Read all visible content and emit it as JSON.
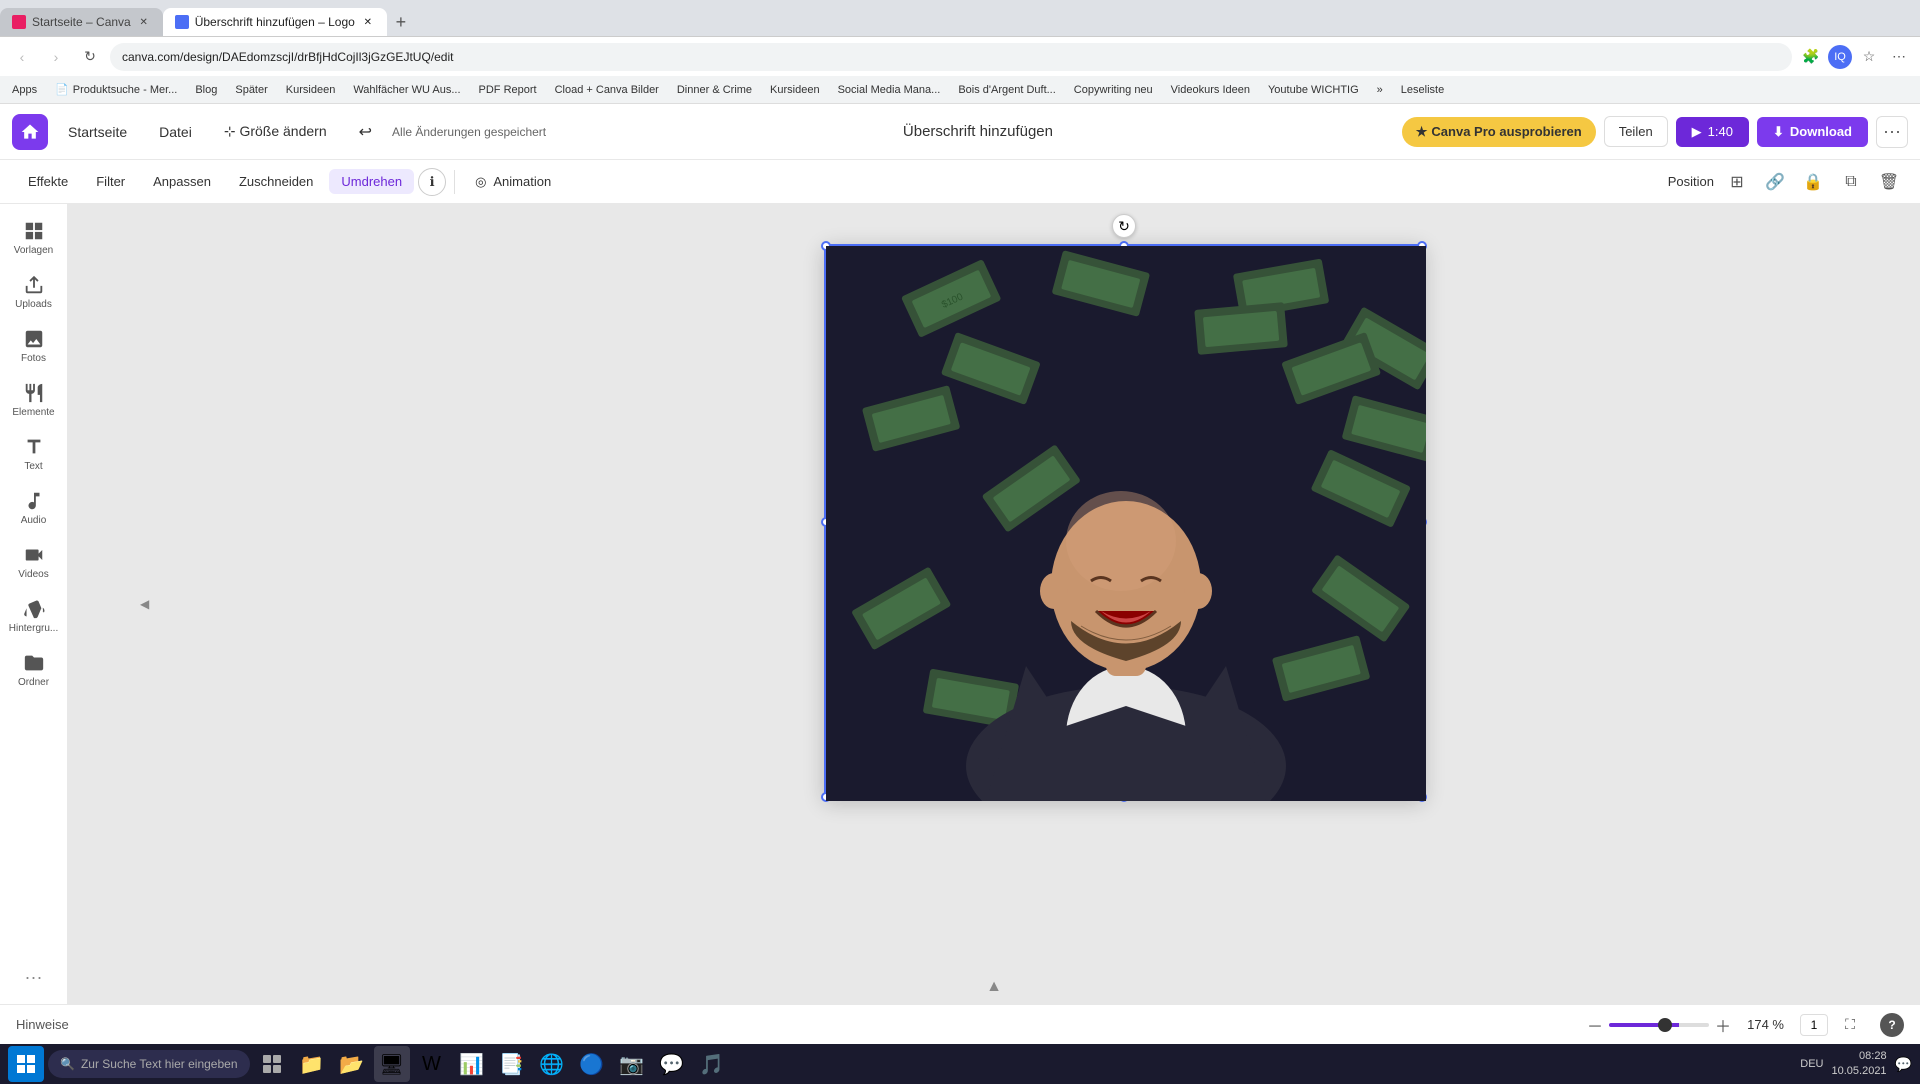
{
  "browser": {
    "tabs": [
      {
        "id": "tab1",
        "label": "Startseite – Canva",
        "active": false,
        "favicon_color": "#e91e63"
      },
      {
        "id": "tab2",
        "label": "Überschrift hinzufügen – Logo",
        "active": true,
        "favicon_color": "#4c6ef5"
      }
    ],
    "new_tab_label": "+",
    "address": "canva.com/design/DAEdomzscjI/drBfjHdCojIl3jGzGEJtUQ/edit",
    "nav": {
      "back": "‹",
      "forward": "›",
      "reload": "↻"
    }
  },
  "bookmarks": [
    "Apps",
    "Produktsuche - Mer...",
    "Blog",
    "Später",
    "Kursideen",
    "Wahlfächer WU Aus...",
    "PDF Report",
    "Cload + Canva Bilder",
    "Dinner & Crime",
    "Kursideen",
    "Social Media Mana...",
    "Bois d'Argent Duft...",
    "Copywriting neu",
    "Videokurs Ideen",
    "Youtube WICHTIG",
    "»",
    "Leseliste"
  ],
  "canva": {
    "topbar": {
      "home_label": "Startseite",
      "file_label": "Datei",
      "resize_label": "Größe ändern",
      "save_status": "Alle Änderungen gespeichert",
      "title": "Überschrift hinzufügen",
      "pro_btn": "Canva Pro ausprobieren",
      "share_btn": "Teilen",
      "play_time": "1:40",
      "download_btn": "Download",
      "more_btn": "···"
    },
    "toolbar": {
      "effects": "Effekte",
      "filter": "Filter",
      "adjust": "Anpassen",
      "crop": "Zuschneiden",
      "flip": "Umdrehen",
      "info": "ℹ",
      "animation": "Animation",
      "position": "Position"
    },
    "sidebar": {
      "items": [
        {
          "id": "vorlagen",
          "label": "Vorlagen",
          "icon": "template-icon"
        },
        {
          "id": "uploads",
          "label": "Uploads",
          "icon": "upload-icon"
        },
        {
          "id": "fotos",
          "label": "Fotos",
          "icon": "photo-icon"
        },
        {
          "id": "elemente",
          "label": "Elemente",
          "icon": "element-icon"
        },
        {
          "id": "text",
          "label": "Text",
          "icon": "text-icon"
        },
        {
          "id": "audio",
          "label": "Audio",
          "icon": "audio-icon"
        },
        {
          "id": "videos",
          "label": "Videos",
          "icon": "video-icon"
        },
        {
          "id": "hintergrund",
          "label": "Hintergru...",
          "icon": "background-icon"
        },
        {
          "id": "ordner",
          "label": "Ordner",
          "icon": "folder-icon"
        }
      ]
    },
    "bottombar": {
      "hints": "Hinweise",
      "zoom_pct": "174 %",
      "page_num": "1"
    }
  },
  "taskbar": {
    "search_placeholder": "Zur Suche Text hier eingeben",
    "clock": "08:28",
    "date": "10.05.2021",
    "locale": "DEU"
  }
}
